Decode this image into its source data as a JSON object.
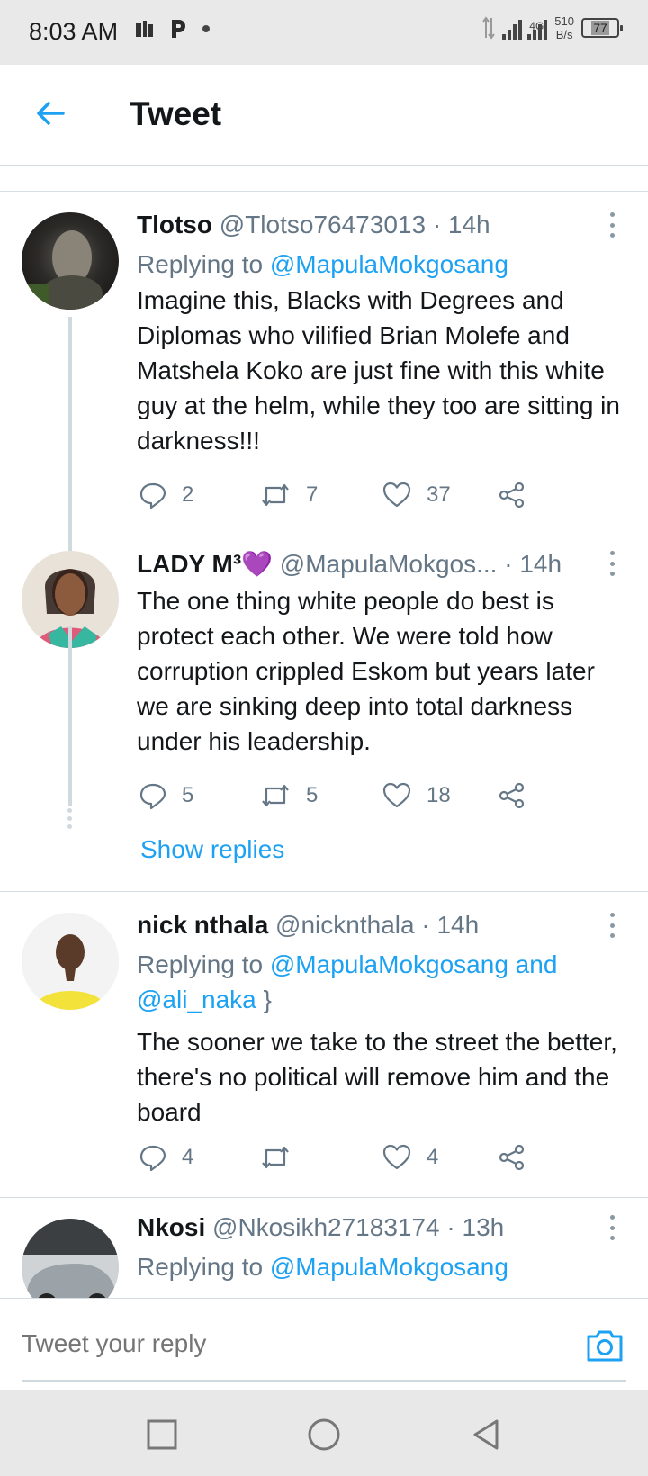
{
  "status_bar": {
    "time": "8:03 AM",
    "icons_left": [
      "sim-icon",
      "parking-app-icon",
      "dot-icon"
    ],
    "network": "4G",
    "speed_value": "510",
    "speed_unit": "B/s",
    "battery": "77"
  },
  "header": {
    "title": "Tweet",
    "back_icon": "arrow-left-icon"
  },
  "tweets": [
    {
      "name": "Tlotso",
      "handle": "@Tlotso76473013",
      "time": "· 14h",
      "replying_prefix": "Replying to",
      "replying_to": "@MapulaMokgosang",
      "body": "Imagine this, Blacks with Degrees and Diplomas who vilified Brian Molefe and Matshela Koko are just fine with this white guy at the helm, while they too are sitting in darkness!!!",
      "replies": "2",
      "retweets": "7",
      "likes": "37"
    },
    {
      "name": "LADY M³💜",
      "handle": "@MapulaMokgos...",
      "time": "· 14h",
      "body": "The one thing white people do best is protect each other. We were told how corruption crippled Eskom but years later we are sinking deep into total darkness under his leadership.",
      "replies": "5",
      "retweets": "5",
      "likes": "18",
      "show_replies": "Show replies"
    },
    {
      "name": "nick nthala",
      "handle": "@nicknthala",
      "time": "· 14h",
      "replying_prefix": "Replying to",
      "replying_to": "@MapulaMokgosang",
      "replying_and": "and",
      "replying_to_2": "@ali_naka",
      "body": "The sooner we take to the street the better, there's no political will remove him and the board",
      "replies": "4",
      "retweets": "",
      "likes": "4"
    },
    {
      "name": "Nkosi",
      "handle": "@Nkosikh27183174",
      "time": "· 13h",
      "replying_prefix": "Replying to",
      "replying_to": "@MapulaMokgosang"
    }
  ],
  "reply_bar": {
    "placeholder": "Tweet your reply",
    "camera_icon": "camera-icon"
  },
  "nav_bar": {
    "icons": [
      "recent-apps-icon",
      "home-icon",
      "back-triangle-icon"
    ]
  },
  "colors": {
    "accent": "#1da1f2",
    "muted": "#657786",
    "divider": "#d6dde3"
  }
}
